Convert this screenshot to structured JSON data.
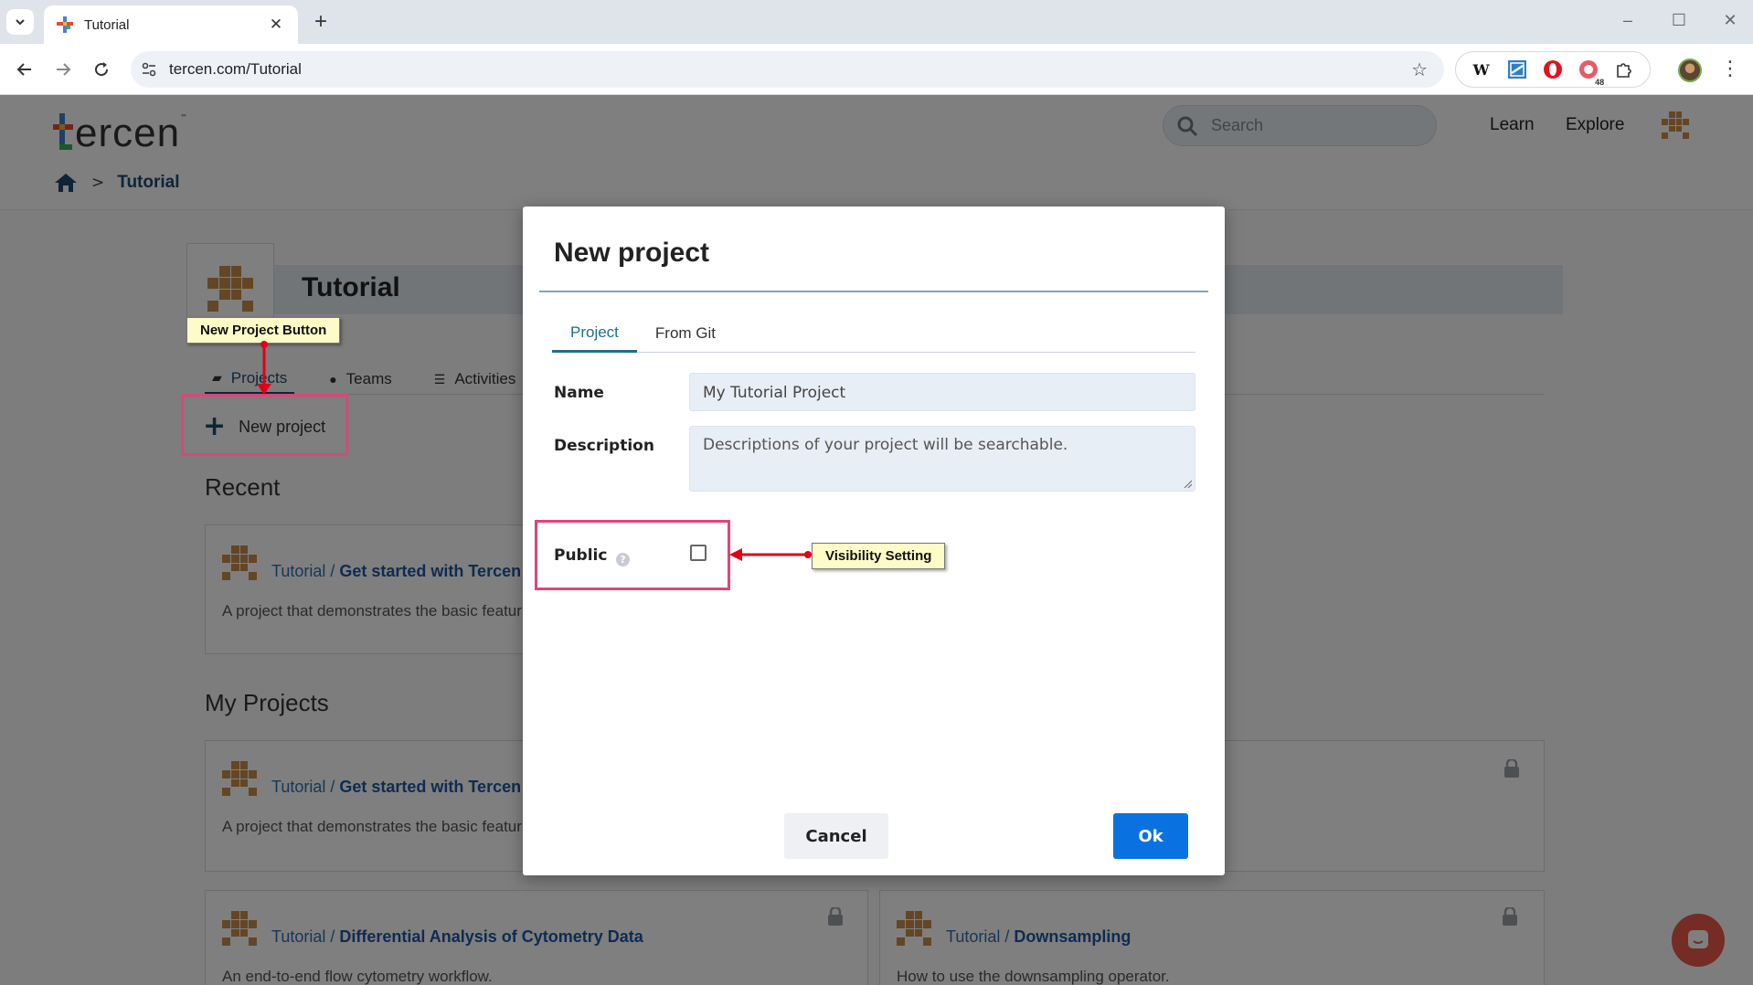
{
  "browser": {
    "tab_title": "Tutorial",
    "url": "tercen.com/Tutorial",
    "extension_badge": "48",
    "colors": {
      "tabstrip": "#dfe4ea",
      "omnibox": "#eef1f6"
    }
  },
  "site": {
    "logo_text": "ercen",
    "logo_tm": "™",
    "search_placeholder": "Search",
    "nav": {
      "learn": "Learn",
      "explore": "Explore"
    },
    "breadcrumb": {
      "separator": ">",
      "current": "Tutorial"
    },
    "colors": {
      "brand_dark": "#1f4a6e",
      "link": "#2f6fb0",
      "mark": "#c98c4a"
    }
  },
  "team": {
    "title": "Tutorial",
    "tabs": [
      {
        "label": "Projects",
        "icon": "folder-open-icon",
        "active": true
      },
      {
        "label": "Teams",
        "icon": "users-icon"
      },
      {
        "label": "Activities",
        "icon": "list-icon"
      }
    ],
    "new_project_label": "New project"
  },
  "sections": {
    "recent": "Recent",
    "my_projects": "My Projects"
  },
  "projects": {
    "recent_card": {
      "owner": "Tutorial /",
      "name": "Get started with Tercen - Vi",
      "desc": "A project that demonstrates the basic featur"
    },
    "my_card_1": {
      "owner": "Tutorial /",
      "name": "Get started with Tercen - Vi",
      "desc": "A project that demonstrates the basic featur"
    },
    "my_card_2": {
      "owner": "Tutorial /",
      "name": "Differential Analysis of Cytometry Data",
      "desc": "An end-to-end flow cytometry workflow."
    },
    "my_card_3": {
      "owner": "Tutorial /",
      "name": "Downsampling",
      "desc": "How to use the downsampling operator."
    }
  },
  "modal": {
    "title": "New project",
    "tabs": [
      {
        "label": "Project",
        "active": true
      },
      {
        "label": "From Git"
      }
    ],
    "name_label": "Name",
    "name_value": "My Tutorial Project",
    "description_label": "Description",
    "description_placeholder": "Descriptions of your project will be searchable.",
    "public_label": "Public",
    "help_glyph": "?",
    "public_checked": false,
    "cancel_label": "Cancel",
    "ok_label": "Ok",
    "colors": {
      "ok": "#0a72e0",
      "accent": "#1f6e8a"
    }
  },
  "annotations": {
    "new_project_callout": "New Project Button",
    "visibility_callout": "Visibility Setting",
    "colors": {
      "highlight_box": "#e0447a",
      "arrow": "#e0001a",
      "callout_bg": "#fdfcc8"
    }
  }
}
